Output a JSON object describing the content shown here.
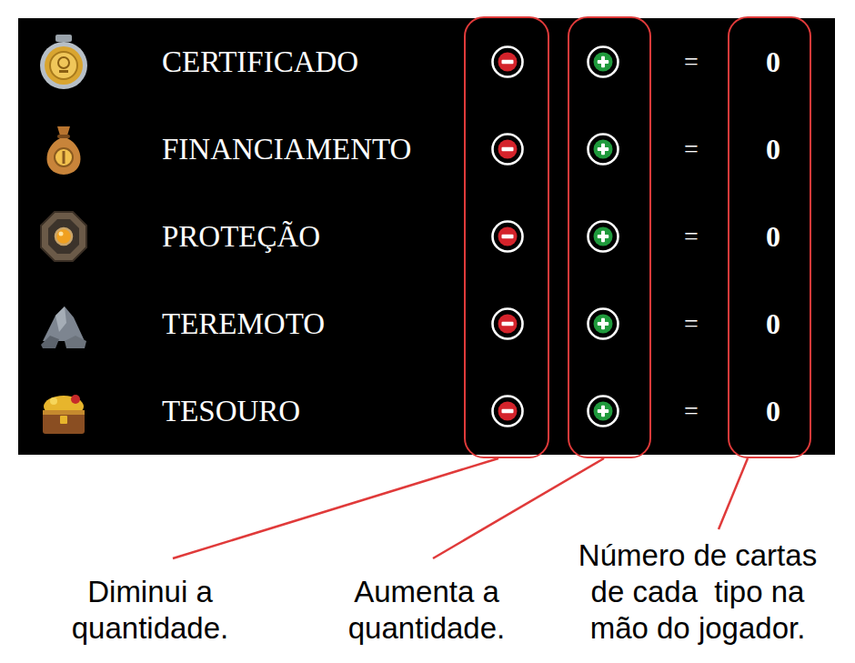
{
  "rows": [
    {
      "kind": "certificate",
      "label": "CERTIFICADO",
      "equals": "=",
      "count": "0"
    },
    {
      "kind": "money-bag",
      "label": "FINANCIAMENTO",
      "equals": "=",
      "count": "0"
    },
    {
      "kind": "shield",
      "label": "PROTEÇÃO",
      "equals": "=",
      "count": "0"
    },
    {
      "kind": "rocks",
      "label": "TEREMOTO",
      "equals": "=",
      "count": "0"
    },
    {
      "kind": "treasure",
      "label": "TESOURO",
      "equals": "=",
      "count": "0"
    }
  ],
  "annotations": [
    {
      "target": "decrease",
      "lines": [
        "Diminui a",
        "quantidade."
      ]
    },
    {
      "target": "increase",
      "lines": [
        "Aumenta a",
        "quantidade."
      ]
    },
    {
      "target": "count",
      "lines": [
        "Número de cartas",
        "de cada  tipo na",
        "mão do jogador."
      ]
    }
  ]
}
